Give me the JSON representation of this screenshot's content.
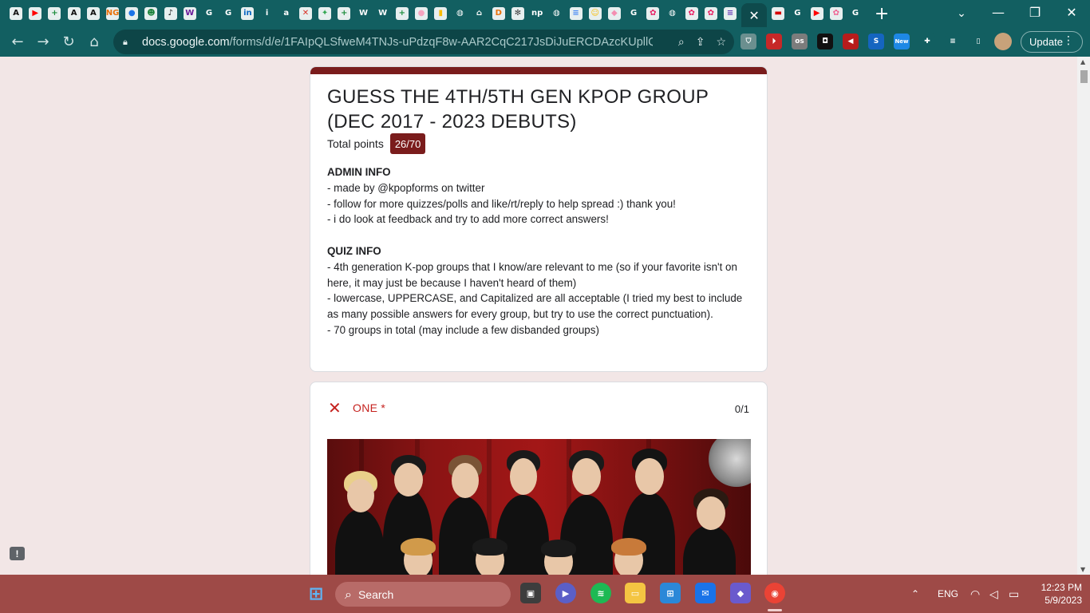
{
  "browser": {
    "tab_favicons": [
      {
        "name": "amazon-a-icon",
        "glyph": "A",
        "color": "#111111"
      },
      {
        "name": "youtube-icon",
        "glyph": "▶",
        "color": "#ff0000"
      },
      {
        "name": "plus-green-icon",
        "glyph": "+",
        "color": "#1e8e3e"
      },
      {
        "name": "a-white-icon",
        "glyph": "A",
        "color": "#111111"
      },
      {
        "name": "a-white-icon-2",
        "glyph": "A",
        "color": "#111111"
      },
      {
        "name": "ng-icon",
        "glyph": "NG",
        "color": "#e8710a"
      },
      {
        "name": "people-icon",
        "glyph": "●",
        "color": "#1a73e8"
      },
      {
        "name": "smiley-icon",
        "glyph": "☻",
        "color": "#188038"
      },
      {
        "name": "music-note-icon",
        "glyph": "♪",
        "color": "#111111"
      },
      {
        "name": "w-purple-icon",
        "glyph": "W",
        "color": "#6a1b9a"
      },
      {
        "name": "google-icon",
        "glyph": "G",
        "color": "#ffffff"
      },
      {
        "name": "google-icon-2",
        "glyph": "G",
        "color": "#ffffff"
      },
      {
        "name": "linkedin-icon",
        "glyph": "in",
        "color": "#0a66c2"
      },
      {
        "name": "info-icon",
        "glyph": "i",
        "color": "#ffffff"
      },
      {
        "name": "amazon-icon",
        "glyph": "a",
        "color": "#ffffff"
      },
      {
        "name": "x-art-icon",
        "glyph": "✕",
        "color": "#d93025"
      },
      {
        "name": "pinwheel-icon",
        "glyph": "✦",
        "color": "#34a853"
      },
      {
        "name": "plus-green-icon-2",
        "glyph": "+",
        "color": "#1e8e3e"
      },
      {
        "name": "wikipedia-icon",
        "glyph": "W",
        "color": "#ffffff"
      },
      {
        "name": "wikipedia-icon-2",
        "glyph": "W",
        "color": "#ffffff"
      },
      {
        "name": "plus-green-icon-3",
        "glyph": "+",
        "color": "#1e8e3e"
      },
      {
        "name": "circle-gradient-icon",
        "glyph": "●",
        "color": "#f6a5c0"
      },
      {
        "name": "bars-icon",
        "glyph": "▮",
        "color": "#fbbc04"
      },
      {
        "name": "globe-icon",
        "glyph": "◍",
        "color": "#ffffff"
      },
      {
        "name": "museum-icon",
        "glyph": "⌂",
        "color": "#ffffff"
      },
      {
        "name": "d-orange-icon",
        "glyph": "D",
        "color": "#e8710a"
      },
      {
        "name": "dots-icon",
        "glyph": "✻",
        "color": "#444444"
      },
      {
        "name": "np-icon",
        "glyph": "np",
        "color": "#ffffff"
      },
      {
        "name": "globe-icon-2",
        "glyph": "◍",
        "color": "#ffffff"
      },
      {
        "name": "docs-icon",
        "glyph": "≡",
        "color": "#4285f4"
      },
      {
        "name": "smile-yellow-icon",
        "glyph": "☺",
        "color": "#fbbc04"
      },
      {
        "name": "pink-diamond-icon",
        "glyph": "◆",
        "color": "#f48fb1"
      },
      {
        "name": "google-icon-3",
        "glyph": "G",
        "color": "#ffffff"
      },
      {
        "name": "pink-app-icon",
        "glyph": "✿",
        "color": "#e91e63"
      },
      {
        "name": "globe-icon-3",
        "glyph": "◍",
        "color": "#ffffff"
      },
      {
        "name": "pink-app-icon-2",
        "glyph": "✿",
        "color": "#e91e63"
      },
      {
        "name": "pink-app-icon-3",
        "glyph": "✿",
        "color": "#e91e63"
      },
      {
        "name": "forms-icon",
        "glyph": "≡",
        "color": "#673ab7"
      }
    ],
    "tab_favicons_after": [
      {
        "name": "red-app-icon",
        "glyph": "▬",
        "color": "#d50000"
      },
      {
        "name": "google-icon-4",
        "glyph": "G",
        "color": "#ffffff"
      },
      {
        "name": "youtube-icon-2",
        "glyph": "▶",
        "color": "#ff0000"
      },
      {
        "name": "pink-square-icon",
        "glyph": "✿",
        "color": "#f06292"
      },
      {
        "name": "google-icon-5",
        "glyph": "G",
        "color": "#ffffff"
      }
    ],
    "url_host": "docs.google.com",
    "url_path": "/forms/d/e/1FAIpQLSfweM4TNJs-uPdzqF8w-AAR2CqC217JsDiJuERCDAzcKUpllQ/vie...",
    "update_label": "Update",
    "extensions": [
      {
        "name": "shield-ext-icon",
        "glyph": "⛉",
        "color": "#6b8f8f"
      },
      {
        "name": "record-ext-icon",
        "glyph": "⏵",
        "color": "#c62828"
      },
      {
        "name": "os-ext-icon",
        "glyph": "os",
        "color": "#7c7c7c"
      },
      {
        "name": "badge-ext-icon",
        "glyph": "◘",
        "color": "#111111"
      },
      {
        "name": "volume-ext-icon",
        "glyph": "◀",
        "color": "#b71c1c"
      },
      {
        "name": "shazam-ext-icon",
        "glyph": "S",
        "color": "#1565c0"
      },
      {
        "name": "new-ext-icon",
        "glyph": "New",
        "color": "#1e88e5"
      },
      {
        "name": "puzzle-ext-icon",
        "glyph": "✚",
        "color": "#125f61"
      },
      {
        "name": "media-ext-icon",
        "glyph": "≡",
        "color": "#125f61"
      },
      {
        "name": "sidebar-ext-icon",
        "glyph": "▯",
        "color": "#125f61"
      }
    ]
  },
  "form": {
    "title": "GUESS THE 4TH/5TH GEN KPOP GROUP (DEC 2017 - 2023 DEBUTS)",
    "total_points_label": "Total points",
    "total_points_value": "26/70",
    "admin_heading": "ADMIN INFO",
    "admin_lines": [
      "- made by @kpopforms on twitter",
      "- follow for more quizzes/polls and like/rt/reply to help spread :) thank you!",
      "- i do look at feedback and try to add more correct answers!"
    ],
    "quiz_heading": "QUIZ INFO",
    "quiz_lines": [
      "- 4th generation K-pop groups that I know/are relevant to me (so if your favorite isn't on here, it may just be because I haven't heard of them)",
      "- lowercase, UPPERCASE, and Capitalized are all acceptable (I tried my best to include as many possible answers for every group, but try to use the correct punctuation).",
      "- 70 groups in total (may include a few disbanded groups)"
    ],
    "question": {
      "title": "ONE *",
      "score": "0/1"
    },
    "accent_color": "#7a1c1c",
    "error_color": "#c5221f"
  },
  "taskbar": {
    "search_label": "Search",
    "language": "ENG",
    "time": "12:23 PM",
    "date": "5/9/2023"
  }
}
